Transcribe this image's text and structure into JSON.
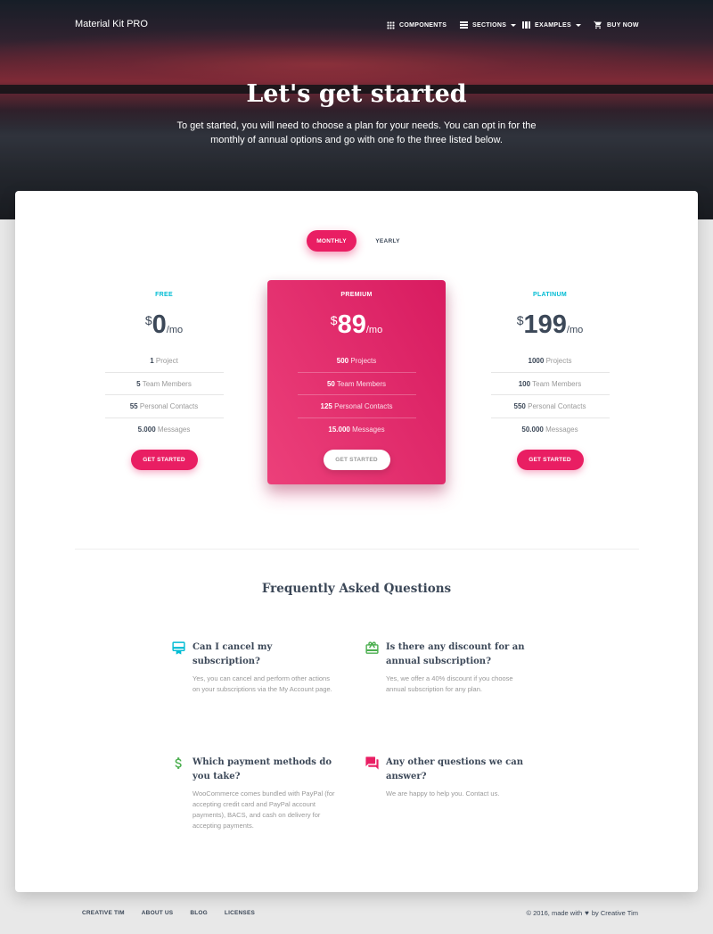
{
  "nav": {
    "brand": "Material Kit PRO",
    "items": [
      {
        "label": "COMPONENTS",
        "icon": "apps-grid-icon"
      },
      {
        "label": "SECTIONS",
        "icon": "view-sections-icon",
        "dropdown": true
      },
      {
        "label": "EXAMPLES",
        "icon": "view-carousel-icon",
        "dropdown": true
      },
      {
        "label": "BUY NOW",
        "icon": "shopping-cart-icon"
      }
    ]
  },
  "hero": {
    "title": "Let's get started",
    "subtitle": "To get started, you will need to choose a plan for your needs. You can opt in for the monthly of annual options and go with one fo the three listed below."
  },
  "toggle": {
    "monthly": "MONTHLY",
    "yearly": "YEARLY",
    "selected": "monthly"
  },
  "plans": [
    {
      "name": "FREE",
      "currency": "$",
      "amount": "0",
      "period": "/mo",
      "features": [
        {
          "value": "1",
          "label": "Project"
        },
        {
          "value": "5",
          "label": "Team Members"
        },
        {
          "value": "55",
          "label": "Personal Contacts"
        },
        {
          "value": "5.000",
          "label": "Messages"
        }
      ],
      "cta": "GET STARTED"
    },
    {
      "name": "PREMIUM",
      "currency": "$",
      "amount": "89",
      "period": "/mo",
      "features": [
        {
          "value": "500",
          "label": "Projects"
        },
        {
          "value": "50",
          "label": "Team Members"
        },
        {
          "value": "125",
          "label": "Personal Contacts"
        },
        {
          "value": "15.000",
          "label": "Messages"
        }
      ],
      "cta": "GET STARTED"
    },
    {
      "name": "PLATINUM",
      "currency": "$",
      "amount": "199",
      "period": "/mo",
      "features": [
        {
          "value": "1000",
          "label": "Projects"
        },
        {
          "value": "100",
          "label": "Team Members"
        },
        {
          "value": "550",
          "label": "Personal Contacts"
        },
        {
          "value": "50.000",
          "label": "Messages"
        }
      ],
      "cta": "GET STARTED"
    }
  ],
  "faq": {
    "title": "Frequently Asked Questions",
    "items": [
      {
        "icon": "card-membership-icon",
        "color": "#00bcd4",
        "question": "Can I cancel my subscription?",
        "answer": "Yes, you can cancel and perform other actions on your subscriptions via the My Account page."
      },
      {
        "icon": "card-giftcard-icon",
        "color": "#4caf50",
        "question": "Is there any discount for an annual subscription?",
        "answer": "Yes, we offer a 40% discount if you choose annual subscription for any plan."
      },
      {
        "icon": "attach-money-icon",
        "color": "#4caf50",
        "question": "Which payment methods do you take?",
        "answer": "WooCommerce comes bundled with PayPal (for accepting credit card and PayPal account payments), BACS, and cash on delivery for accepting payments."
      },
      {
        "icon": "question-answer-icon",
        "color": "#e91e63",
        "question": "Any other questions we can answer?",
        "answer": "We are happy to help you. Contact us."
      }
    ]
  },
  "footer": {
    "links": [
      "CREATIVE TIM",
      "ABOUT US",
      "BLOG",
      "LICENSES"
    ],
    "copyright_prefix": "© 2016, made with",
    "copyright_suffix": "by Creative Tim"
  },
  "colors": {
    "accent": "#e91e63",
    "info": "#00bcd4",
    "success": "#4caf50",
    "text": "#3c4858",
    "muted": "#999999"
  }
}
